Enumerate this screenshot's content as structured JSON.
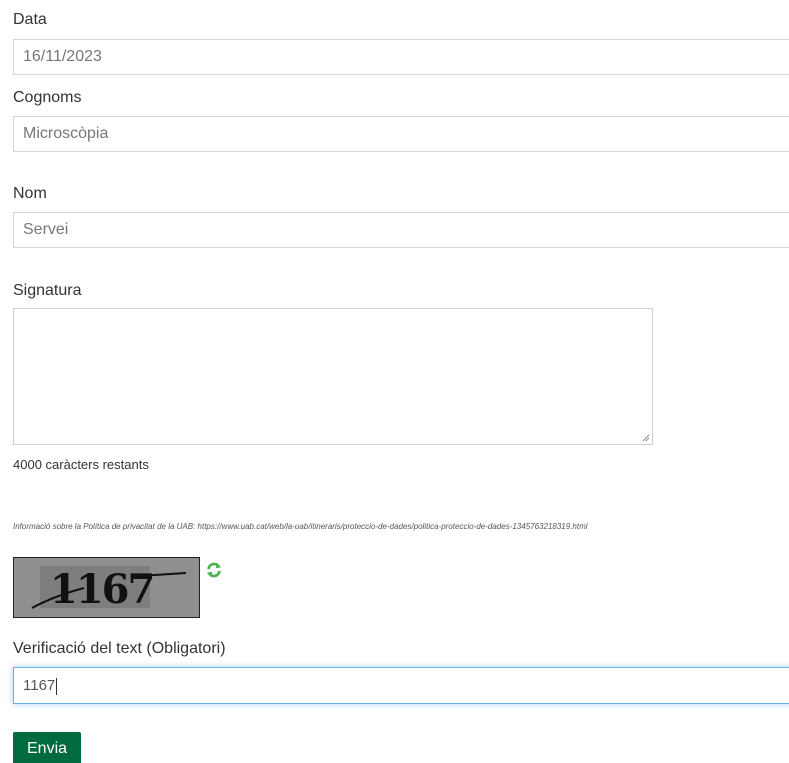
{
  "form": {
    "date": {
      "label": "Data",
      "value": "16/11/2023"
    },
    "surname": {
      "label": "Cognoms",
      "value": "Microscòpia"
    },
    "name": {
      "label": "Nom",
      "value": "Servei"
    },
    "signature": {
      "label": "Signatura",
      "value": "",
      "remaining": "4000 caràcters restants"
    },
    "privacy_note": "Informació sobre la Política de privacitat de la UAB: https://www.uab.cat/web/la-uab/itineraris/proteccio-de-dades/politica-proteccio-de-dades-1345763218319.html",
    "captcha": {
      "text": "1167",
      "refresh_icon": "refresh-icon"
    },
    "verification": {
      "label": "Verificació del text (Obligatori)",
      "value": "1167"
    },
    "submit_label": "Envia"
  },
  "colors": {
    "button_bg": "#006b3f",
    "focus_border": "#66afe9",
    "refresh_icon": "#4caf50"
  }
}
